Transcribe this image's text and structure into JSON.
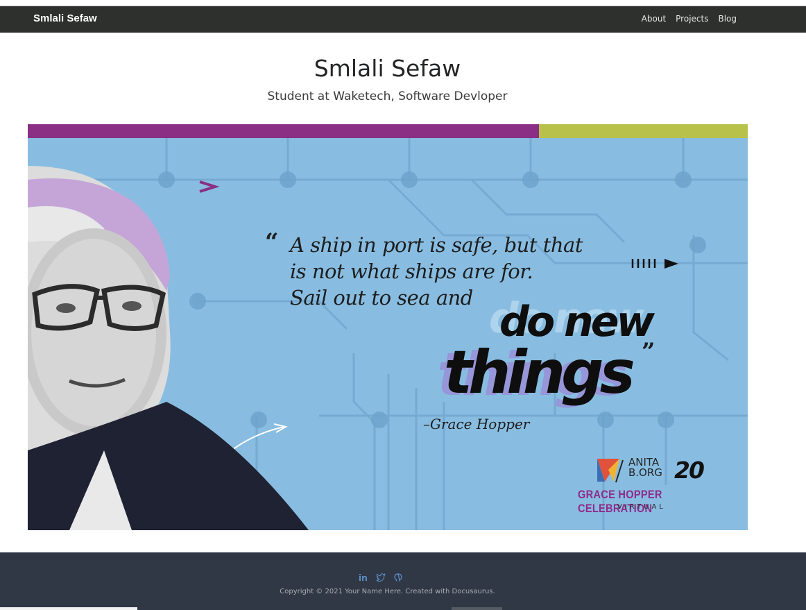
{
  "nav": {
    "brand": "Smlali Sefaw",
    "links": [
      "About",
      "Projects",
      "Blog"
    ]
  },
  "hero": {
    "title": "Smlali Sefaw",
    "subtitle": "Student at Waketech, Software Devloper"
  },
  "banner": {
    "quote_open": "“",
    "quote_lines": [
      "A ship in port is safe, but that",
      "is not what ships are for.",
      "Sail out to sea and"
    ],
    "highlight_1": "do new",
    "highlight_2": "things",
    "quote_close": "”",
    "attribution": "–Grace Hopper",
    "org_line_1": "ANITA",
    "org_line_2": "B.ORG",
    "year_mark": "20",
    "event": "GRACE HOPPER CELEBRATION",
    "event_sub": "VIRTUAL",
    "colors": {
      "background": "#88bde1",
      "purple_bar": "#8a2f83",
      "green_bar": "#b8c24a",
      "event_text": "#8f2c8a"
    }
  },
  "footer": {
    "social_icons": [
      "linkedin-icon",
      "twitter-icon",
      "github-icon"
    ],
    "copyright": "Copyright © 2021 Your Name Here. Created with Docusaurus."
  }
}
